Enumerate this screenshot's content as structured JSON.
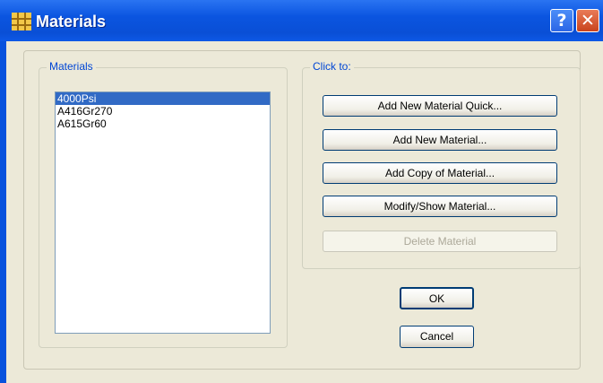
{
  "window": {
    "title": "Materials",
    "icon": "grid-icon"
  },
  "titlebar_buttons": {
    "help": "?",
    "close": "✕"
  },
  "materials_group": {
    "label": "Materials",
    "items": [
      "4000Psi",
      "A416Gr270",
      "A615Gr60"
    ],
    "selected_index": 0
  },
  "actions_group": {
    "label": "Click to:",
    "buttons": [
      {
        "label": "Add New Material Quick...",
        "enabled": true
      },
      {
        "label": "Add New Material...",
        "enabled": true
      },
      {
        "label": "Add Copy of Material...",
        "enabled": true
      },
      {
        "label": "Modify/Show Material...",
        "enabled": true
      },
      {
        "label": "Delete Material",
        "enabled": false
      }
    ]
  },
  "ok_label": "OK",
  "cancel_label": "Cancel"
}
